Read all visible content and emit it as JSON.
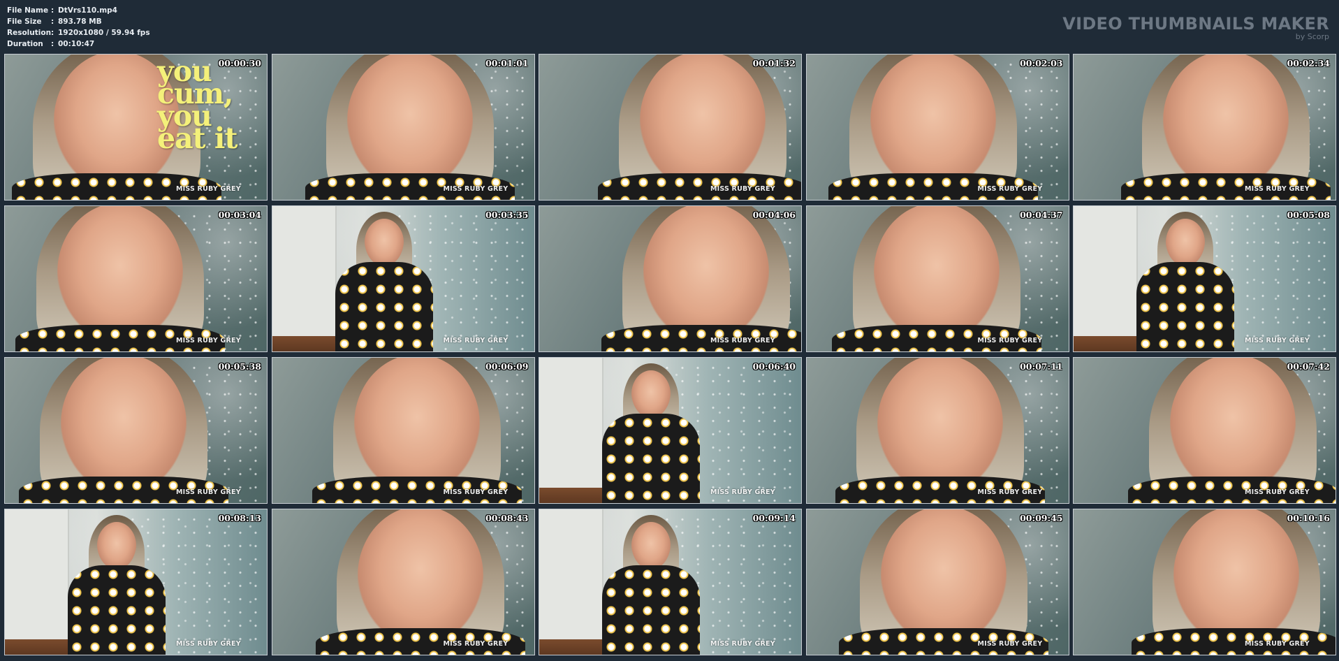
{
  "file_info": [
    {
      "key": "File Name",
      "value": "DtVrs110.mp4"
    },
    {
      "key": "File Size",
      "value": "893.78 MB"
    },
    {
      "key": "Resolution",
      "value": "1920x1080 / 59.94 fps"
    },
    {
      "key": "Duration",
      "value": "00:10:47"
    }
  ],
  "separator": ":",
  "brand": {
    "title": "VIDEO THUMBNAILS MAKER",
    "subtitle": "by Scorp"
  },
  "first_thumb_overlay": "you\ncum,\nyou\neat it",
  "thumbnails": [
    {
      "time": "00:00:30",
      "watermark": "MISS RUBY GREY",
      "scene": "close"
    },
    {
      "time": "00:01:01",
      "watermark": "MISS RUBY GREY",
      "scene": "close"
    },
    {
      "time": "00:01:32",
      "watermark": "MISS RUBY GREY",
      "scene": "close"
    },
    {
      "time": "00:02:03",
      "watermark": "MISS RUBY GREY",
      "scene": "close"
    },
    {
      "time": "00:02:34",
      "watermark": "MISS RUBY GREY",
      "scene": "close"
    },
    {
      "time": "00:03:04",
      "watermark": "MISS RUBY GREY",
      "scene": "close"
    },
    {
      "time": "00:03:35",
      "watermark": "MISS RUBY GREY",
      "scene": "room"
    },
    {
      "time": "00:04:06",
      "watermark": "MISS RUBY GREY",
      "scene": "close"
    },
    {
      "time": "00:04:37",
      "watermark": "MISS RUBY GREY",
      "scene": "close"
    },
    {
      "time": "00:05:08",
      "watermark": "MISS RUBY GREY",
      "scene": "room"
    },
    {
      "time": "00:05:38",
      "watermark": "MISS RUBY GREY",
      "scene": "close"
    },
    {
      "time": "00:06:09",
      "watermark": "MISS RUBY GREY",
      "scene": "close"
    },
    {
      "time": "00:06:40",
      "watermark": "MISS RUBY GREY",
      "scene": "room"
    },
    {
      "time": "00:07:11",
      "watermark": "MISS RUBY GREY",
      "scene": "close"
    },
    {
      "time": "00:07:42",
      "watermark": "MISS RUBY GREY",
      "scene": "close"
    },
    {
      "time": "00:08:13",
      "watermark": "MISS RUBY GREY",
      "scene": "room"
    },
    {
      "time": "00:08:43",
      "watermark": "MISS RUBY GREY",
      "scene": "close"
    },
    {
      "time": "00:09:14",
      "watermark": "MISS RUBY GREY",
      "scene": "room"
    },
    {
      "time": "00:09:45",
      "watermark": "MISS RUBY GREY",
      "scene": "close"
    },
    {
      "time": "00:10:16",
      "watermark": "MISS RUBY GREY",
      "scene": "close"
    }
  ],
  "colors": {
    "background": "#1f2b37",
    "brand_text": "#6d7884",
    "overlay_text": "#f4f07a"
  }
}
